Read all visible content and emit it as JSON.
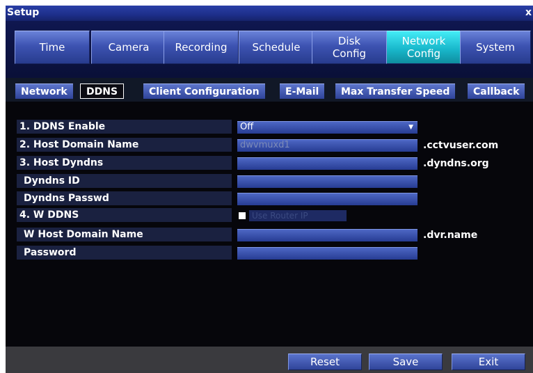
{
  "window": {
    "title": "Setup",
    "close_label": "x"
  },
  "main_tabs": [
    {
      "label": "Time",
      "active": false
    },
    {
      "label": "Camera",
      "active": false
    },
    {
      "label": "Recording",
      "active": false
    },
    {
      "label": "Schedule",
      "active": false
    },
    {
      "label": "Disk\nConfig",
      "active": false
    },
    {
      "label": "Network\nConfig",
      "active": true
    },
    {
      "label": "System",
      "active": false
    }
  ],
  "sub_tabs": [
    {
      "label": "Network",
      "active": false
    },
    {
      "label": "DDNS",
      "active": true
    },
    {
      "label": "Client Configuration",
      "active": false
    },
    {
      "label": "E-Mail",
      "active": false
    },
    {
      "label": "Max Transfer Speed",
      "active": false
    },
    {
      "label": "Callback",
      "active": false
    }
  ],
  "form": {
    "ddns_enable": {
      "label": "1. DDNS Enable",
      "value": "Off"
    },
    "host_domain_name": {
      "label": "2. Host Domain Name",
      "value": "dwvmuxd1",
      "suffix": ".cctvuser.com"
    },
    "host_dyndns": {
      "label": "3. Host Dyndns",
      "value": "",
      "suffix": ".dyndns.org"
    },
    "dyndns_id": {
      "label": "Dyndns ID",
      "value": ""
    },
    "dyndns_passwd": {
      "label": "Dyndns Passwd",
      "value": ""
    },
    "w_ddns": {
      "label": "4. W DDNS",
      "checkbox_label": "Use Router IP"
    },
    "w_host_domain_name": {
      "label": "W Host Domain Name",
      "value": "",
      "suffix": ".dvr.name"
    },
    "password": {
      "label": "Password",
      "value": ""
    }
  },
  "buttons": {
    "reset": "Reset",
    "save": "Save",
    "exit": "Exit"
  },
  "colors": {
    "active_tab": "#19b8cc",
    "tab": "#3d53b2",
    "background": "#06060b"
  }
}
